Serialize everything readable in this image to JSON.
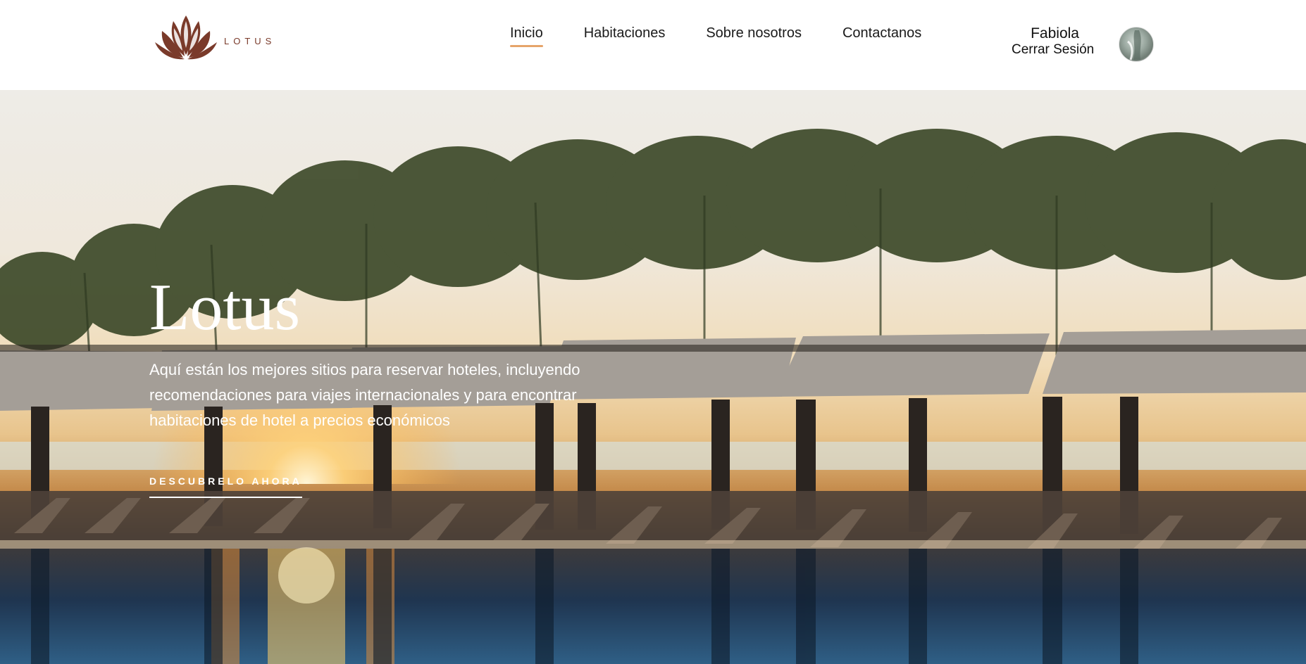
{
  "brand": {
    "name": "LOTUS",
    "color": "#7a3a2a"
  },
  "nav": {
    "items": [
      {
        "label": "Inicio",
        "active": true
      },
      {
        "label": "Habitaciones",
        "active": false
      },
      {
        "label": "Sobre nosotros",
        "active": false
      },
      {
        "label": "Contactanos",
        "active": false
      }
    ],
    "active_underline_color": "#e6a46a"
  },
  "user": {
    "name": "Fabiola",
    "logout_label": "Cerrar Sesión",
    "avatar_icon": "user-avatar"
  },
  "hero": {
    "title": "Lotus",
    "description": "Aquí están los mejores sitios para reservar hoteles, incluyendo recomendaciones para viajes internacionales y para encontrar habitaciones de hotel a precios económicos",
    "cta_label": "DESCUBRELO AHORA"
  }
}
